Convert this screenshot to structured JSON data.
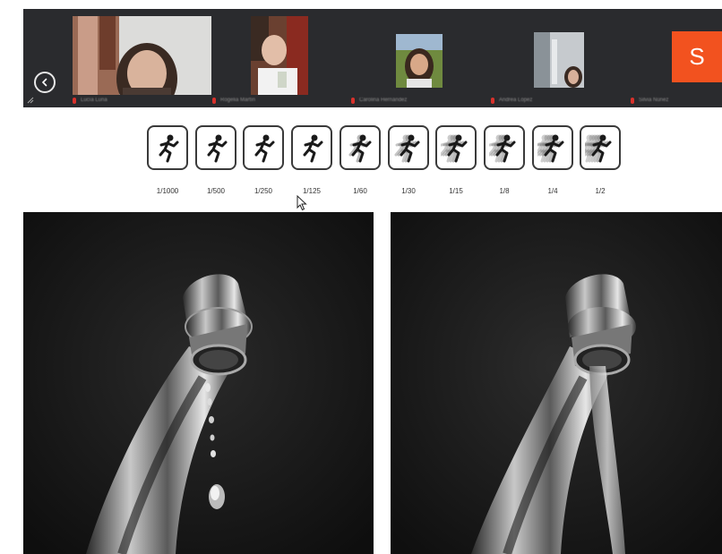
{
  "strip": {
    "participants": [
      {
        "name": "Lucía Luna"
      },
      {
        "name": "Rogelia Martín"
      },
      {
        "name": "Carolina Hernández"
      },
      {
        "name": "Andrea López"
      },
      {
        "name": "Silvia Núñez"
      }
    ],
    "avatar_letter": "S",
    "colors": {
      "strip_bg": "#2a2b2e",
      "avatar_bg": "#f2521f",
      "mic": "#d8312b"
    }
  },
  "shutter_speeds": [
    {
      "label": "1/1000",
      "blur": 0
    },
    {
      "label": "1/500",
      "blur": 0
    },
    {
      "label": "1/250",
      "blur": 0
    },
    {
      "label": "1/125",
      "blur": 0
    },
    {
      "label": "1/60",
      "blur": 1
    },
    {
      "label": "1/30",
      "blur": 2
    },
    {
      "label": "1/15",
      "blur": 3
    },
    {
      "label": "1/8",
      "blur": 3
    },
    {
      "label": "1/4",
      "blur": 4
    },
    {
      "label": "1/2",
      "blur": 5
    }
  ],
  "photos": {
    "left": {
      "icon": "dripping-faucet"
    },
    "right": {
      "icon": "running-faucet"
    }
  }
}
